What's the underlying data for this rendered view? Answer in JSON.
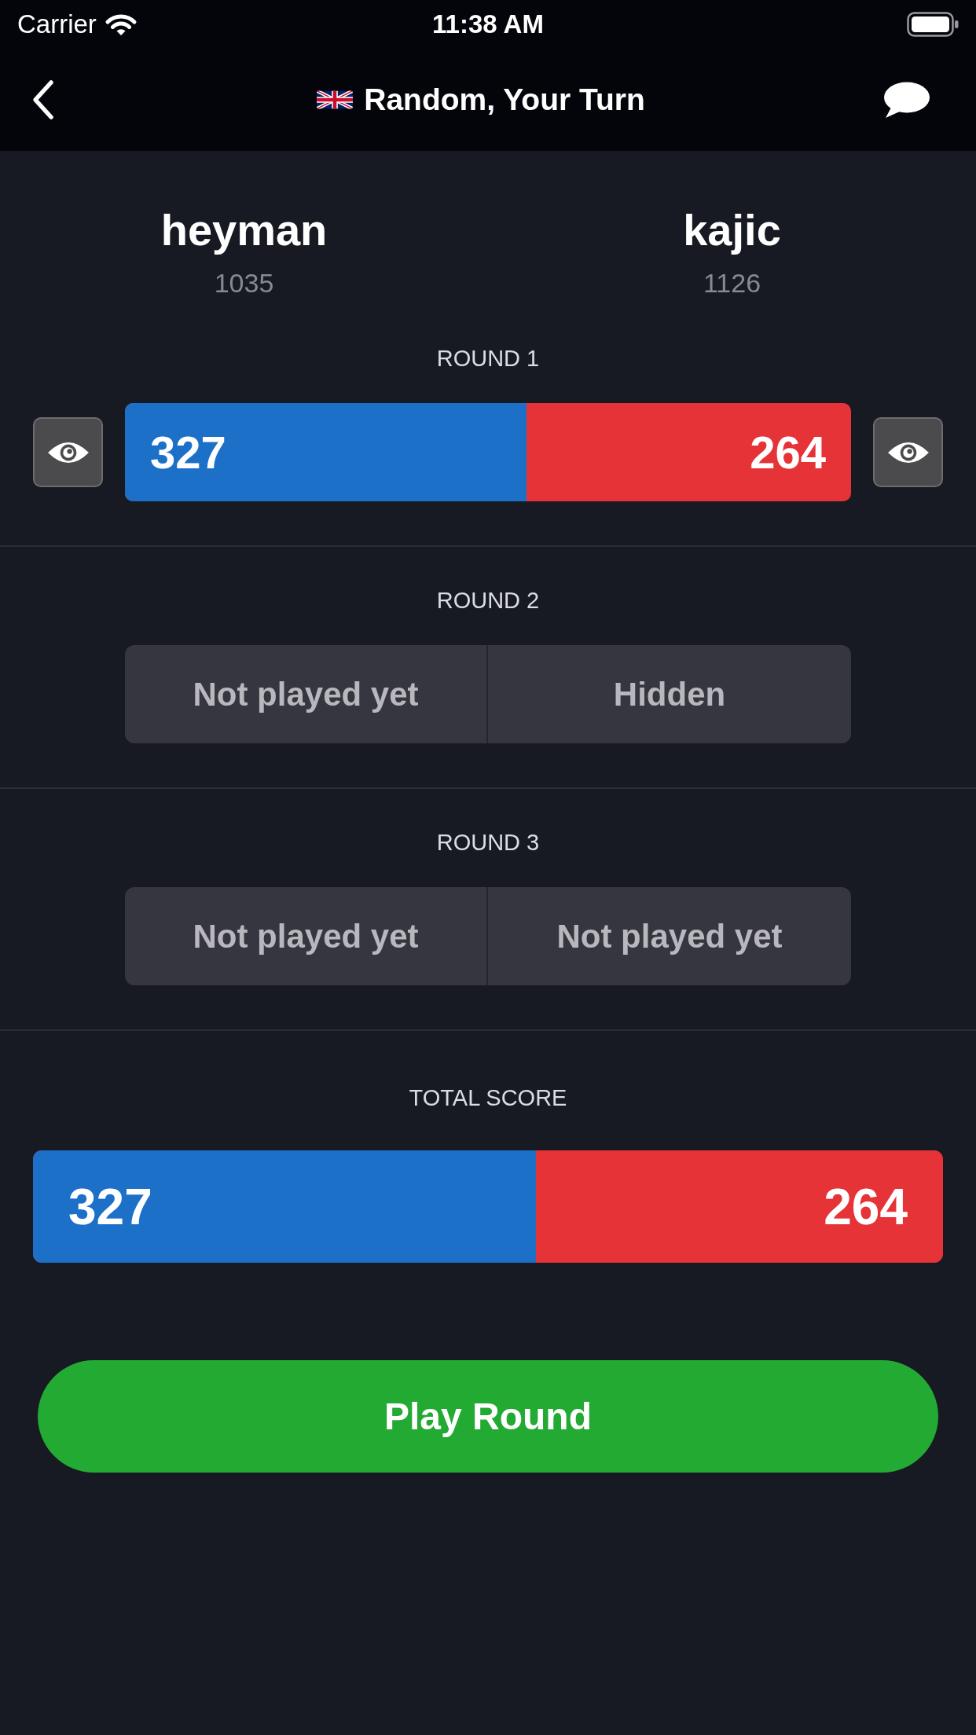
{
  "status_bar": {
    "carrier": "Carrier",
    "time": "11:38 AM"
  },
  "header": {
    "title": "Random, Your Turn"
  },
  "players": [
    {
      "name": "heyman",
      "rating": "1035"
    },
    {
      "name": "kajic",
      "rating": "1126"
    }
  ],
  "rounds": [
    {
      "label": "ROUND 1",
      "kind": "scored",
      "scores": [
        "327",
        "264"
      ],
      "level": 0.553
    },
    {
      "label": "ROUND 2",
      "kind": "pending",
      "cells": [
        "Not played yet",
        "Hidden"
      ]
    },
    {
      "label": "ROUND 3",
      "kind": "pending",
      "cells": [
        "Not played yet",
        "Not played yet"
      ]
    }
  ],
  "total": {
    "label": "TOTAL SCORE",
    "scores": [
      "327",
      "264"
    ],
    "level": 0.553
  },
  "play_button": {
    "label": "Play Round"
  }
}
